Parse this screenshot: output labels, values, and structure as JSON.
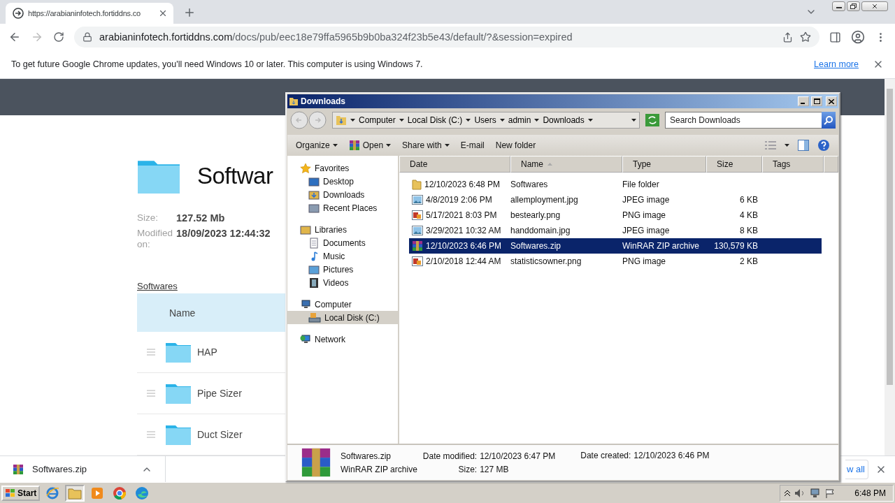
{
  "browser": {
    "tab": {
      "title": "https://arabianinfotech.fortiddns.co"
    },
    "url": {
      "host": "arabianinfotech.fortiddns.com",
      "path": "/docs/pub/eec18e79ffa5965b9b0ba324f23b5e43/default/?&session=expired"
    },
    "notice": {
      "message": "To get future Google Chrome updates, you'll need Windows 10 or later. This computer is using Windows 7.",
      "link": "Learn more"
    }
  },
  "page": {
    "title": "Softwar",
    "size_label": "Size:",
    "size": "127.52 Mb",
    "modified_label": "Modified on:",
    "modified": "18/09/2023 12:44:32",
    "breadcrumb": "Softwares",
    "column": "Name",
    "items": [
      {
        "name": "HAP"
      },
      {
        "name": "Pipe Sizer"
      },
      {
        "name": "Duct Sizer"
      }
    ]
  },
  "downloads_bar": {
    "file": "Softwares.zip",
    "show_all": "w all"
  },
  "explorer": {
    "title": "Downloads",
    "path": [
      "Computer",
      "Local Disk (C:)",
      "Users",
      "admin",
      "Downloads"
    ],
    "search": {
      "placeholder": "Search Downloads"
    },
    "toolbar": [
      {
        "label": "Organize",
        "kind": "menu"
      },
      {
        "label": "Open",
        "kind": "open"
      },
      {
        "label": "Share with",
        "kind": "menu"
      },
      {
        "label": "E-mail",
        "kind": "plain"
      },
      {
        "label": "New folder",
        "kind": "plain"
      }
    ],
    "nav": [
      {
        "label": "Favorites",
        "kind": "favorites",
        "selected": false,
        "children": [
          {
            "label": "Desktop",
            "kind": "desktop",
            "selected": false
          },
          {
            "label": "Downloads",
            "kind": "downloads",
            "selected": false
          },
          {
            "label": "Recent Places",
            "kind": "recent",
            "selected": false
          }
        ]
      },
      {
        "label": "Libraries",
        "kind": "libraries",
        "selected": false,
        "children": [
          {
            "label": "Documents",
            "kind": "documents",
            "selected": false
          },
          {
            "label": "Music",
            "kind": "music",
            "selected": false
          },
          {
            "label": "Pictures",
            "kind": "pictures",
            "selected": false
          },
          {
            "label": "Videos",
            "kind": "videos",
            "selected": false
          }
        ]
      },
      {
        "label": "Computer",
        "kind": "computer",
        "selected": false,
        "children": [
          {
            "label": "Local Disk (C:)",
            "kind": "disk",
            "selected": true
          }
        ]
      },
      {
        "label": "Network",
        "kind": "network",
        "selected": false
      }
    ],
    "columns": [
      {
        "label": "Date",
        "sorted": false
      },
      {
        "label": "Name",
        "sorted": true
      },
      {
        "label": "Type",
        "sorted": false
      },
      {
        "label": "Size",
        "sorted": false
      },
      {
        "label": "Tags",
        "sorted": false
      }
    ],
    "files": [
      {
        "kind": "folder",
        "date": "12/10/2023 6:48 PM",
        "name": "Softwares",
        "type": "File folder",
        "selected": false
      },
      {
        "kind": "jpeg",
        "date": "4/8/2019 2:06 PM",
        "name": "allemployment.jpg",
        "type": "JPEG image",
        "size": "6 KB",
        "selected": false
      },
      {
        "kind": "png",
        "date": "5/17/2021 8:03 PM",
        "name": "bestearly.png",
        "type": "PNG image",
        "size": "4 KB",
        "selected": false
      },
      {
        "kind": "jpeg",
        "date": "3/29/2021 10:32 AM",
        "name": "handdomain.jpg",
        "type": "JPEG image",
        "size": "8 KB",
        "selected": false
      },
      {
        "kind": "archive",
        "date": "12/10/2023 6:46 PM",
        "name": "Softwares.zip",
        "type": "WinRAR ZIP archive",
        "size": "130,579 KB",
        "selected": true
      },
      {
        "kind": "png",
        "date": "2/10/2018 12:44 AM",
        "name": "statisticsowner.png",
        "type": "PNG image",
        "size": "2 KB",
        "selected": false
      }
    ],
    "details": {
      "name": "Softwares.zip",
      "type": "WinRAR ZIP archive",
      "fields": [
        {
          "label": "Date modified:",
          "value": "12/10/2023 6:47 PM"
        },
        {
          "label": "Size:",
          "value": "127 MB"
        },
        {
          "label": "Date created:",
          "value": "12/10/2023 6:46 PM"
        }
      ]
    }
  },
  "taskbar": {
    "start": "Start",
    "apps": [
      {
        "kind": "ie",
        "active": false
      },
      {
        "kind": "explorer",
        "active": true
      },
      {
        "kind": "media",
        "active": false
      },
      {
        "kind": "chrome",
        "active": false
      },
      {
        "kind": "edge",
        "active": false
      }
    ],
    "clock": "6:48 PM"
  }
}
